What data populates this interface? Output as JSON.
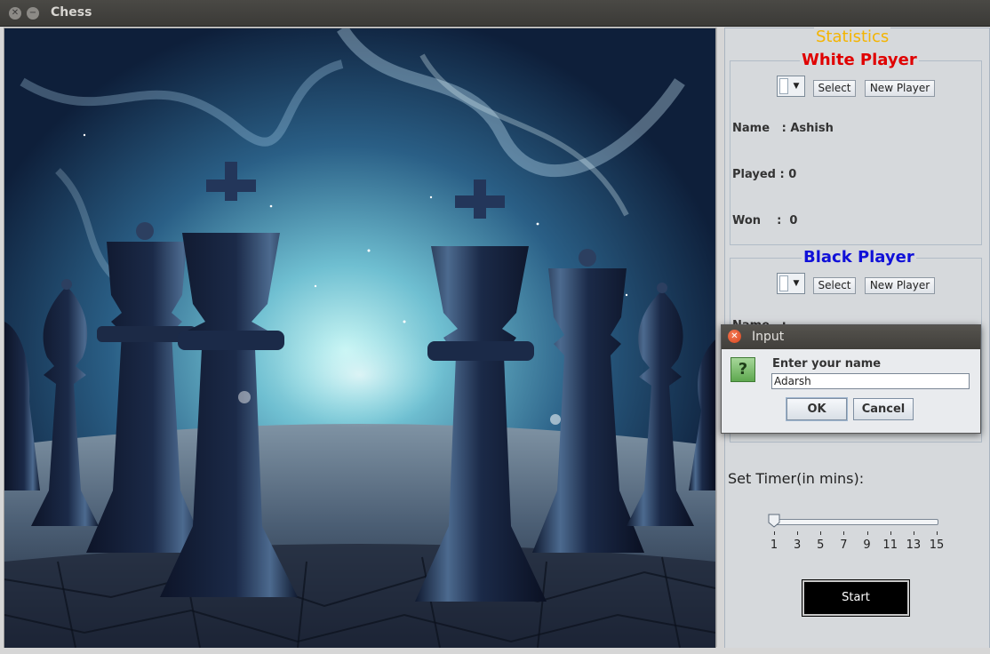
{
  "window": {
    "title": "Chess"
  },
  "panel": {
    "stats_title": "Statistics",
    "white": {
      "title": "White Player",
      "select_label": "Select",
      "new_player_label": "New Player",
      "name_text": "Name   : Ashish",
      "played_text": "Played : 0",
      "won_text": "Won    :  0"
    },
    "black": {
      "title": "Black Player",
      "select_label": "Select",
      "new_player_label": "New Player",
      "name_text": "Name   :"
    },
    "timer": {
      "label": "Set Timer(in mins):",
      "value": 1,
      "ticks": [
        "1",
        "3",
        "5",
        "7",
        "9",
        "11",
        "13",
        "15"
      ]
    },
    "start_label": "Start"
  },
  "dialog": {
    "title": "Input",
    "prompt": "Enter your name",
    "input_value": "Adarsh",
    "ok_label": "OK",
    "cancel_label": "Cancel"
  },
  "colors": {
    "stats_title": "#f4b400",
    "white_title": "#e00000",
    "black_title": "#1010d8"
  }
}
